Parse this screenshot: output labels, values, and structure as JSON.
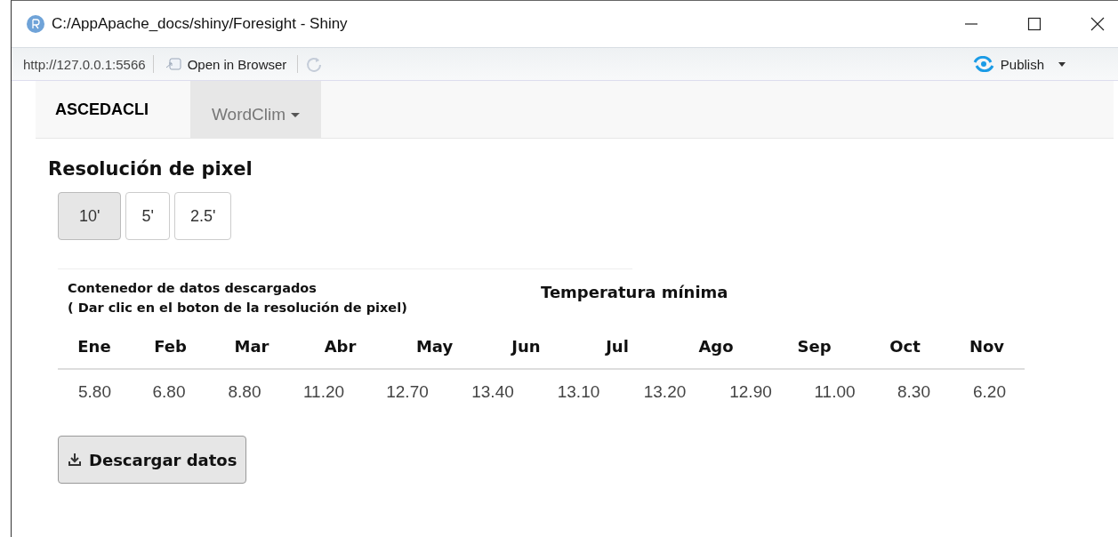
{
  "window": {
    "title": "C:/AppApache_docs/shiny/Foresight - Shiny"
  },
  "toolbar": {
    "url": "http://127.0.0.1:5566",
    "open_browser": "Open in Browser",
    "publish": "Publish"
  },
  "navbar": {
    "brand": "ASCEDACLI",
    "menus": [
      {
        "label": "WordClim",
        "selected": true
      }
    ]
  },
  "heading": "Resolución de pixel",
  "resolution_buttons": [
    {
      "label": "10'",
      "selected": true
    },
    {
      "label": "5'",
      "selected": false
    },
    {
      "label": "2.5'",
      "selected": false
    }
  ],
  "container_note": [
    "Contenedor de datos descargados",
    "( Dar clic en el boton de la resolución de pixel)"
  ],
  "table_title": "Temperatura mínima",
  "table": {
    "columns": [
      "Ene",
      "Feb",
      "Mar",
      "Abr",
      "May",
      "Jun",
      "Jul",
      "Ago",
      "Sep",
      "Oct",
      "Nov"
    ],
    "values": [
      "5.80",
      "6.80",
      "8.80",
      "11.20",
      "12.70",
      "13.40",
      "13.10",
      "13.20",
      "12.90",
      "11.00",
      "8.30",
      "6.20"
    ]
  },
  "download_button": "Descargar datos"
}
